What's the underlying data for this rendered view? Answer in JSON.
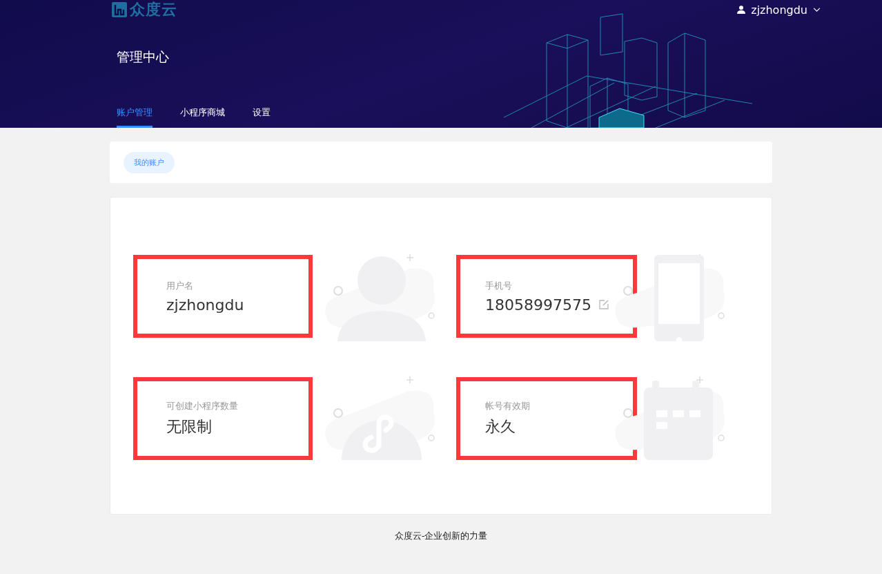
{
  "header": {
    "logo": "众度云",
    "title": "管理中心",
    "user": "zjzhongdu"
  },
  "tabs": [
    {
      "label": "账户管理",
      "selected": true
    },
    {
      "label": "小程序商城",
      "selected": false
    },
    {
      "label": "设置",
      "selected": false
    }
  ],
  "breadcrumb": "我的账户",
  "fields": [
    {
      "label": "用户名",
      "value": "zjzhongdu",
      "kind": "person",
      "editable": false,
      "highlighted": true
    },
    {
      "label": "手机号",
      "value": "18058997575",
      "kind": "phone",
      "editable": true,
      "highlighted": true
    },
    {
      "label": "可创建小程序数量",
      "value": "无限制",
      "kind": "miniprogram",
      "editable": false,
      "highlighted": true
    },
    {
      "label": "帐号有效期",
      "value": "永久",
      "kind": "calendar",
      "editable": false,
      "highlighted": true
    }
  ],
  "footer": "众度云-企业创新的力量"
}
